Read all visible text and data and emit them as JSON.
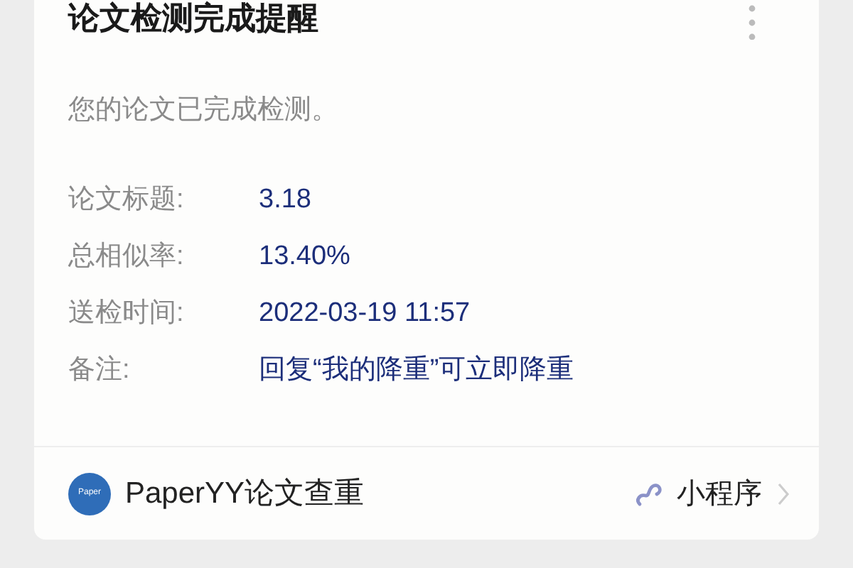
{
  "card": {
    "title": "论文检测完成提醒",
    "message": "您的论文已完成检测。",
    "fields": [
      {
        "label": "论文标题:",
        "value": "3.18"
      },
      {
        "label": "总相似率:",
        "value": "13.40%"
      },
      {
        "label": "送检时间:",
        "value": "2022-03-19 11:57"
      },
      {
        "label": "备注:",
        "value": "回复“我的降重”可立即降重"
      }
    ],
    "footer": {
      "logo_text": "Paper",
      "app_name": "PaperYY论文查重",
      "badge": "小程序"
    }
  }
}
